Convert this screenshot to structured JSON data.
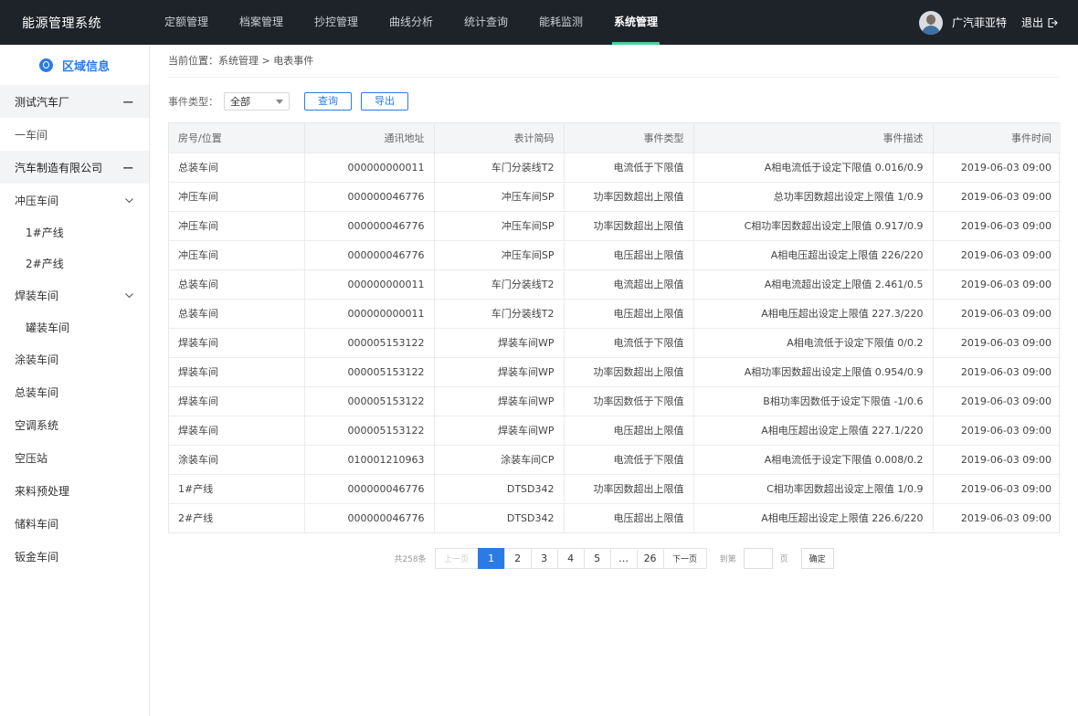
{
  "app": {
    "title": "能源管理系统"
  },
  "nav": [
    {
      "label": "定额管理"
    },
    {
      "label": "档案管理"
    },
    {
      "label": "抄控管理"
    },
    {
      "label": "曲线分析"
    },
    {
      "label": "统计查询"
    },
    {
      "label": "能耗监测"
    },
    {
      "label": "系统管理",
      "active": true
    }
  ],
  "user": {
    "name": "广汽菲亚特",
    "logout": "退出"
  },
  "sidebar": {
    "title": "区域信息",
    "items": [
      {
        "label": "测试汽车厂",
        "level": "group",
        "toggle": "−"
      },
      {
        "label": "一车间",
        "level": "top-light"
      },
      {
        "label": "汽车制造有限公司",
        "level": "group",
        "toggle": "−"
      },
      {
        "label": "冲压车间",
        "level": "top",
        "toggle": "chevron"
      },
      {
        "label": "1#产线",
        "level": "sub"
      },
      {
        "label": "2#产线",
        "level": "sub"
      },
      {
        "label": "焊装车间",
        "level": "top",
        "toggle": "chevron"
      },
      {
        "label": "罐装车间",
        "level": "sub"
      },
      {
        "label": "涂装车间",
        "level": "top"
      },
      {
        "label": "总装车间",
        "level": "top"
      },
      {
        "label": "空调系统",
        "level": "top"
      },
      {
        "label": "空压站",
        "level": "top"
      },
      {
        "label": "来料预处理",
        "level": "top"
      },
      {
        "label": "储料车间",
        "level": "top"
      },
      {
        "label": "钣金车间",
        "level": "top"
      }
    ]
  },
  "breadcrumb": "当前位置：系统管理 > 电表事件",
  "filter": {
    "label": "事件类型：",
    "selected": "全部",
    "query": "查询",
    "export": "导出"
  },
  "table": {
    "columns": [
      "房号/位置",
      "通讯地址",
      "表计简码",
      "事件类型",
      "事件描述",
      "事件时间"
    ],
    "rows": [
      [
        "总装车间",
        "000000000011",
        "车门分装线T2",
        "电流低于下限值",
        "A相电流低于设定下限值 0.016/0.9",
        "2019-06-03 09:00"
      ],
      [
        "冲压车间",
        "000000046776",
        "冲压车间SP",
        "功率因数超出上限值",
        "总功率因数超出设定上限值 1/0.9",
        "2019-06-03 09:00"
      ],
      [
        "冲压车间",
        "000000046776",
        "冲压车间SP",
        "功率因数超出上限值",
        "C相功率因数超出设定上限值 0.917/0.9",
        "2019-06-03 09:00"
      ],
      [
        "冲压车间",
        "000000046776",
        "冲压车间SP",
        "电压超出上限值",
        "A相电压超出设定上限值 226/220",
        "2019-06-03 09:00"
      ],
      [
        "总装车间",
        "000000000011",
        "车门分装线T2",
        "电流超出上限值",
        "A相电流超出设定上限值 2.461/0.5",
        "2019-06-03 09:00"
      ],
      [
        "总装车间",
        "000000000011",
        "车门分装线T2",
        "电压超出上限值",
        "A相电压超出设定上限值 227.3/220",
        "2019-06-03 09:00"
      ],
      [
        "焊装车间",
        "000005153122",
        "焊装车间WP",
        "电流低于下限值",
        "A相电流低于设定下限值 0/0.2",
        "2019-06-03 09:00"
      ],
      [
        "焊装车间",
        "000005153122",
        "焊装车间WP",
        "功率因数超出上限值",
        "A相功率因数超出设定上限值 0.954/0.9",
        "2019-06-03 09:00"
      ],
      [
        "焊装车间",
        "000005153122",
        "焊装车间WP",
        "功率因数低于下限值",
        "B相功率因数低于设定下限值 -1/0.6",
        "2019-06-03 09:00"
      ],
      [
        "焊装车间",
        "000005153122",
        "焊装车间WP",
        "电压超出上限值",
        "A相电压超出设定上限值 227.1/220",
        "2019-06-03 09:00"
      ],
      [
        "涂装车间",
        "010001210963",
        "涂装车间CP",
        "电流低于下限值",
        "A相电流低于设定下限值 0.008/0.2",
        "2019-06-03 09:00"
      ],
      [
        "1#产线",
        "000000046776",
        "DTSD342",
        "功率因数超出上限值",
        "C相功率因数超出设定上限值 1/0.9",
        "2019-06-03 09:00"
      ],
      [
        "2#产线",
        "000000046776",
        "DTSD342",
        "电压超出上限值",
        "A相电压超出设定上限值 226.6/220",
        "2019-06-03 09:00"
      ]
    ]
  },
  "pagination": {
    "total": "共258条",
    "prev": "上一页",
    "pages": [
      "1",
      "2",
      "3",
      "4",
      "5",
      "…",
      "26"
    ],
    "current": "1",
    "next": "下一页",
    "goto_prefix": "到第",
    "goto_suffix": "页",
    "confirm": "确定"
  },
  "colors": {
    "accent": "#2c7be5",
    "nav_indicator": "#4bd29a",
    "topbar": "#1e2329"
  }
}
